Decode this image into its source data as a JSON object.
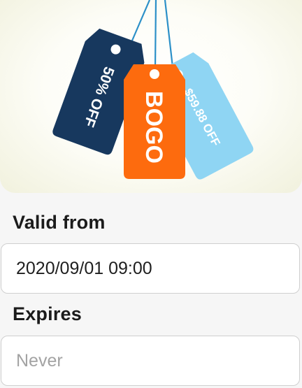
{
  "hero": {
    "tags": [
      {
        "text": "50% OFF",
        "color": "#17385e"
      },
      {
        "text": "BOGO",
        "color": "#fd6b0e"
      },
      {
        "text": "$59.88 OFF",
        "color": "#8fd5f3"
      }
    ],
    "string_color": "#2c90c8"
  },
  "form": {
    "valid_from": {
      "label": "Valid from",
      "value": "2020/09/01 09:00"
    },
    "expires": {
      "label": "Expires",
      "placeholder": "Never",
      "value": ""
    }
  }
}
